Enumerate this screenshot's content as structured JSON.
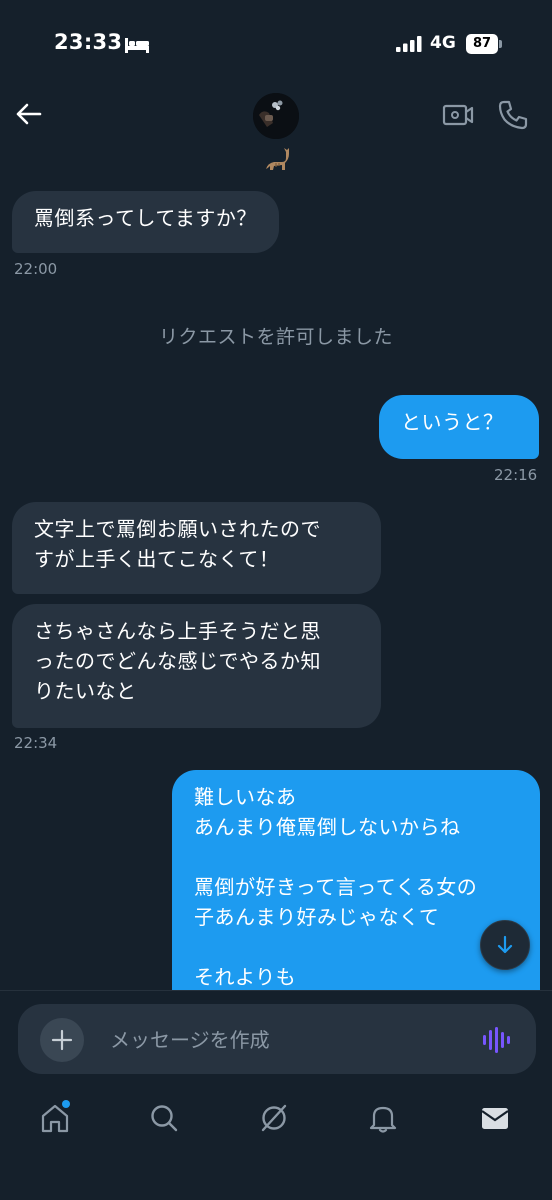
{
  "status_bar": {
    "time": "23:33",
    "network": "4G",
    "battery": "87"
  },
  "header": {
    "icons": [
      "back-arrow-icon",
      "avatar",
      "cat-emoji",
      "video-call-icon",
      "phone-icon"
    ]
  },
  "messages": [
    {
      "id": "m1",
      "direction": "incoming",
      "text": "罵倒系ってしてますか？"
    },
    {
      "id": "m2",
      "direction": "outgoing",
      "text": "というと？"
    },
    {
      "id": "m3",
      "direction": "incoming",
      "text": "文字上で罵倒お願いされたので\nすが上手く出てこなくて！"
    },
    {
      "id": "m4",
      "direction": "incoming",
      "text": "さちゃさんなら上手そうだと思\nったのでどんな感じでやるか知\nりたいなと"
    },
    {
      "id": "m5",
      "direction": "outgoing",
      "text": "難しいなあ\nあんまり俺罵倒しないからね\n\n罵倒が好きって言ってくる女の\n子あんまり好みじゃなくて\n\nそれよりも"
    }
  ],
  "timestamps": {
    "t1": "22:00",
    "t2": "22:16",
    "t3": "22:34"
  },
  "system_note": "リクエストを許可しました",
  "composer": {
    "placeholder": "メッセージを作成"
  },
  "bottom_nav": {
    "items": [
      "home-icon",
      "search-icon",
      "grok-icon",
      "notifications-icon",
      "messages-icon"
    ]
  },
  "colors": {
    "background": "#15202b",
    "incoming_bubble": "#273340",
    "outgoing_bubble": "#1d9bf0",
    "muted_text": "#8b98a5",
    "voice_accent": "#7856ff"
  }
}
